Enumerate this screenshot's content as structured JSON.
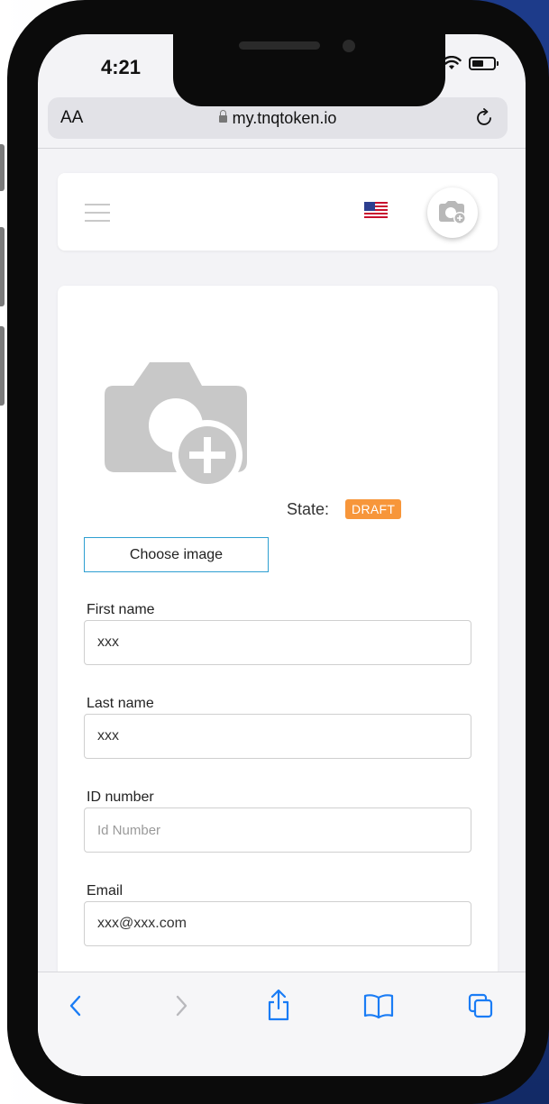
{
  "status_bar": {
    "time": "4:21"
  },
  "stray_text": "AA",
  "browser": {
    "text_size_control": "AA",
    "url": "my.tnqtoken.io"
  },
  "header": {
    "menu_icon": "hamburger-icon",
    "language_flag": "us-flag-icon",
    "profile_photo_icon": "camera-add-icon"
  },
  "profile": {
    "photo_icon": "camera-add-icon",
    "state_label": "State:",
    "state_value": "DRAFT",
    "state_color": "#f7963a",
    "choose_image_label": "Choose image"
  },
  "form": {
    "fields": [
      {
        "label": "First name",
        "value": "xxx",
        "placeholder": ""
      },
      {
        "label": "Last name",
        "value": "xxx",
        "placeholder": ""
      },
      {
        "label": "ID number",
        "value": "",
        "placeholder": "Id Number"
      },
      {
        "label": "Email",
        "value": "xxx@xxx.com",
        "placeholder": ""
      }
    ]
  },
  "toolbar": {
    "back_icon": "chevron-left-icon",
    "forward_icon": "chevron-right-icon",
    "share_icon": "share-icon",
    "bookmarks_icon": "book-icon",
    "tabs_icon": "tabs-icon",
    "accent": "#1a7cf5"
  }
}
